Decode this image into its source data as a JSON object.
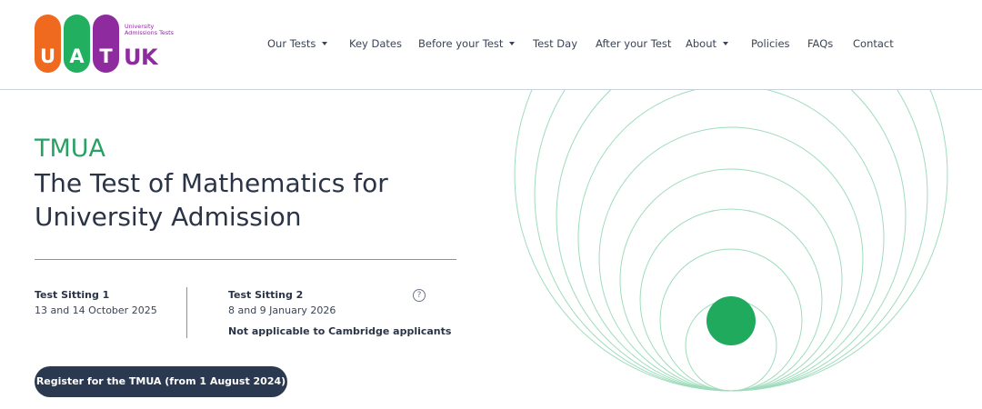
{
  "logo": {
    "letters": [
      "U",
      "A",
      "T"
    ],
    "small_text": "University Admissions Tests",
    "uk": "UK",
    "colors": {
      "u": "#ef6a1f",
      "a": "#22b060",
      "t": "#8e2b9f"
    }
  },
  "nav": {
    "items": [
      {
        "label": "Our Tests",
        "dropdown": true
      },
      {
        "label": "Key Dates",
        "dropdown": false
      },
      {
        "label": "Before your Test",
        "dropdown": true
      },
      {
        "label": "Test Day",
        "dropdown": false
      },
      {
        "label": "After your Test",
        "dropdown": false
      },
      {
        "label": "About",
        "dropdown": true
      },
      {
        "label": "Policies",
        "dropdown": false
      },
      {
        "label": "FAQs",
        "dropdown": false
      },
      {
        "label": "Contact",
        "dropdown": false
      }
    ]
  },
  "hero": {
    "eyebrow": "TMUA",
    "title": "The Test of Mathematics for University Admission"
  },
  "sittings": [
    {
      "label": "Test Sitting 1",
      "dates": "13 and 14 October 2025"
    },
    {
      "label": "Test Sitting 2",
      "dates": "8 and 9 January 2026",
      "note": "Not applicable to Cambridge applicants"
    }
  ],
  "help_icon_glyph": "?",
  "register_button": "Register for the TMUA (from 1 August 2024)",
  "colors": {
    "accent_green": "#2aa066",
    "navy": "#2b3950",
    "circle_stroke": "#9fdcbc",
    "dot_fill": "#1faa5e"
  }
}
